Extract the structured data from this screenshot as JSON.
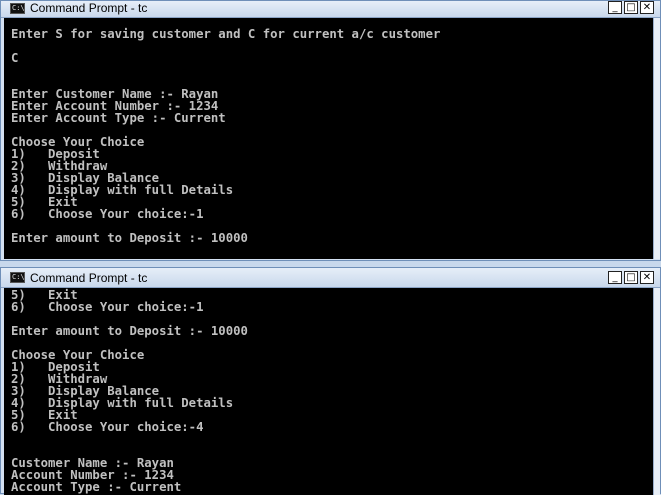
{
  "windows": [
    {
      "title": "Command Prompt - tc",
      "icon": "cmd-icon",
      "controls": {
        "minimize": "_",
        "maximize": "□",
        "close": "✕"
      },
      "lines": [
        "Enter S for saving customer and C for current a/c customer",
        "C",
        "Enter Customer Name :- Rayan",
        "Enter Account Number :- 1234",
        "Enter Account Type :- Current",
        "Choose Your Choice",
        "1)   Deposit",
        "2)   Withdraw",
        "3)   Display Balance",
        "4)   Display with full Details",
        "5)   Exit",
        "6)   Choose Your choice:-1",
        "Enter amount to Deposit :- 10000"
      ]
    },
    {
      "title": "Command Prompt - tc",
      "icon": "cmd-icon",
      "controls": {
        "minimize": "_",
        "maximize": "□",
        "close": "✕"
      },
      "lines": [
        "5)   Exit",
        "6)   Choose Your choice:-1",
        "Enter amount to Deposit :- 10000",
        "Choose Your Choice",
        "1)   Deposit",
        "2)   Withdraw",
        "3)   Display Balance",
        "4)   Display with full Details",
        "5)   Exit",
        "6)   Choose Your choice:-4",
        "Customer Name :- Rayan",
        "Account Number :- 1234",
        "Account Type :- Current"
      ]
    }
  ],
  "colors": {
    "console_bg": "#000000",
    "console_text": "#c0c0c0",
    "titlebar": "#d4e1f2"
  }
}
